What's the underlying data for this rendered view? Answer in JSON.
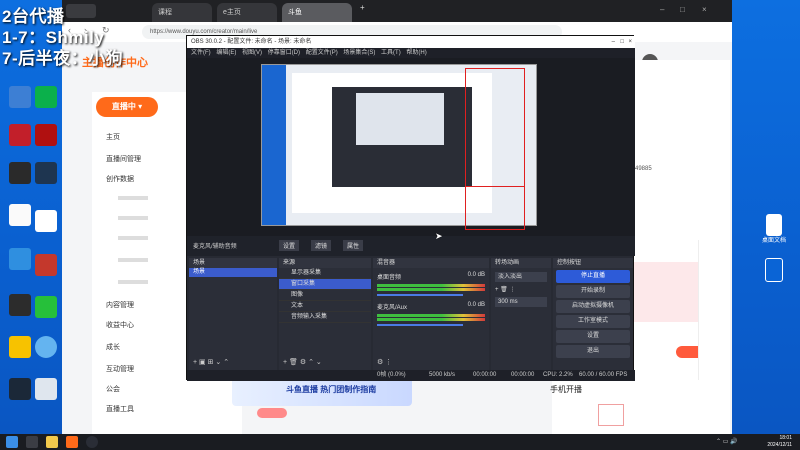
{
  "overlay": {
    "line1": "2台代播",
    "line2": "1-7：Shmily",
    "line3": "7-后半夜：小狗"
  },
  "desktop_right_icon_label": "桌面文档",
  "browser": {
    "tabs": [
      "课程",
      "e主页",
      "斗鱼"
    ],
    "url": "https://www.douyu.com/creator/main/live"
  },
  "site": {
    "banner": "主播创作中心",
    "live_button": "直播中",
    "nav": [
      {
        "label": "主页"
      },
      {
        "label": "直播间管理"
      },
      {
        "label": "创作数据"
      },
      {
        "label": "内容管理"
      },
      {
        "label": "收益中心"
      },
      {
        "label": "成长"
      },
      {
        "label": "互动管理"
      },
      {
        "label": "公会"
      },
      {
        "label": "直播工具"
      }
    ],
    "promo_title": "斗鱼直播 热门团制作指南",
    "right_panel": {
      "title": "手机开播",
      "link": "com/49885"
    }
  },
  "obs": {
    "title": "OBS 30.0.2 - 配置文件: 未命名 - 场景: 未命名",
    "menu": [
      "文件(F)",
      "编辑(E)",
      "视图(V)",
      "停靠窗口(D)",
      "配置文件(P)",
      "场景集合(S)",
      "工具(T)",
      "帮助(H)"
    ],
    "docks_bar": [
      "麦克风/辅助音频",
      "设置",
      "滤镜",
      "属性"
    ],
    "docks": {
      "scenes": {
        "title": "场景",
        "items": [
          "场景"
        ]
      },
      "sources": {
        "title": "来源",
        "items": [
          "显示器采集",
          "窗口采集",
          "图像",
          "文本",
          "音频输入采集"
        ]
      },
      "mixer": {
        "title": "混音器",
        "tracks": [
          {
            "name": "桌面音频",
            "level": "0.0 dB"
          },
          {
            "name": "麦克风/Aux",
            "level": "0.0 dB"
          }
        ]
      },
      "transitions": {
        "title": "转场动画",
        "type": "淡入淡出",
        "duration": "300 ms"
      },
      "controls": {
        "title": "控制按钮",
        "buttons": [
          "停止直播",
          "开始录制",
          "启动虚拟摄像机",
          "工作室模式",
          "设置",
          "退出"
        ]
      }
    },
    "status": {
      "dropped": "0帧 (0.0%)",
      "bitrate": "5000 kb/s",
      "live_time": "00:00:00",
      "rec_time": "00:00:00",
      "cpu": "CPU: 2.2%",
      "fps": "60.00 / 60.00 FPS"
    }
  },
  "taskbar": {
    "time": "18:01",
    "date": "2024/12/11"
  },
  "colors": {
    "accent": "#ff6a1a",
    "obs_bg": "#272a33",
    "obs_select": "#3b5ccc",
    "desktop": "#0a64d6",
    "selection_red": "#e02020"
  }
}
